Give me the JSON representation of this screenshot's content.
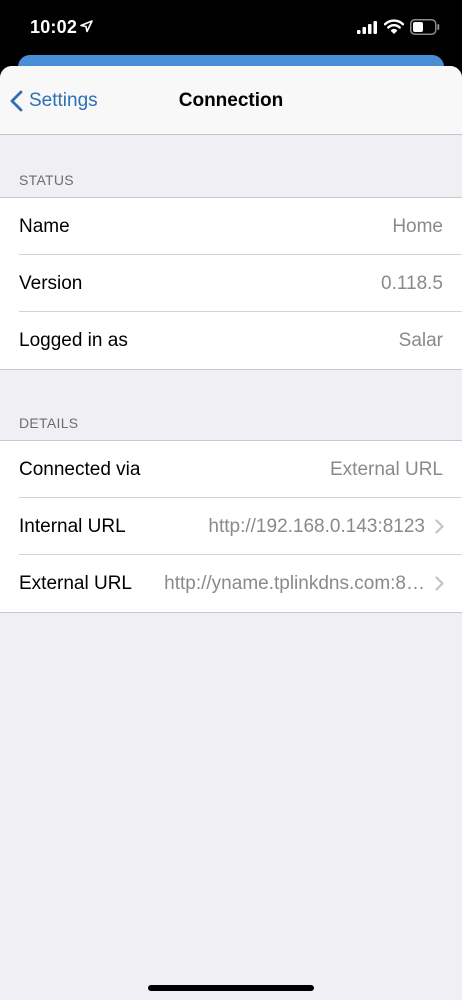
{
  "status_bar": {
    "time": "10:02",
    "icons": [
      "location-arrow-icon",
      "cellular-signal-icon",
      "wifi-icon",
      "battery-icon"
    ]
  },
  "nav": {
    "back_label": "Settings",
    "title": "Connection"
  },
  "status_section": {
    "header": "STATUS",
    "rows": [
      {
        "label": "Name",
        "value": "Home"
      },
      {
        "label": "Version",
        "value": "0.118.5"
      },
      {
        "label": "Logged in as",
        "value": "Salar"
      }
    ]
  },
  "details_section": {
    "header": "DETAILS",
    "rows": [
      {
        "label": "Connected via",
        "value": "External URL"
      },
      {
        "label": "Internal URL",
        "value": "http://192.168.0.143:8123"
      },
      {
        "label": "External URL",
        "value": "http://yname.tplinkdns.com:8…"
      }
    ]
  },
  "colors": {
    "accent": "#2f6fb2",
    "background": "#efeff4",
    "secondary_text": "#8a8a8e",
    "header_sheet": "#4a8fd6"
  }
}
